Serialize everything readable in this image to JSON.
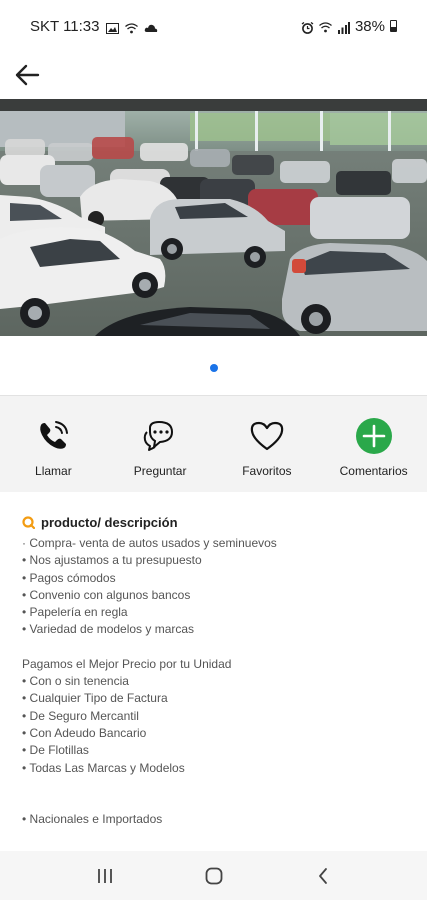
{
  "status_bar": {
    "carrier_time": "SKT 11:33",
    "battery": "38%"
  },
  "colors": {
    "accent_blue": "#1a73e8",
    "comment_green": "#2aa84a",
    "tag_orange": "#f39c12"
  },
  "actions": [
    {
      "label": "Llamar",
      "icon": "phone-icon"
    },
    {
      "label": "Preguntar",
      "icon": "chat-bubbles-icon"
    },
    {
      "label": "Favoritos",
      "icon": "heart-icon"
    },
    {
      "label": "Comentarios",
      "icon": "plus-circle-icon"
    }
  ],
  "description": {
    "title": "producto/ descripción",
    "lines_1": [
      "· Compra- venta de autos usados y seminuevos",
      "• Nos ajustamos a tu presupuesto",
      "• Pagos cómodos",
      "• Convenio con algunos bancos",
      "• Papelería en regla",
      "• Variedad de modelos y marcas"
    ],
    "lines_2": [
      "Pagamos el Mejor Precio por tu Unidad",
      "• Con o sin tenencia",
      "• Cualquier Tipo de Factura",
      "• De Seguro Mercantil",
      "• Con Adeudo Bancario",
      "• De Flotillas",
      "• Todas Las Marcas y Modelos"
    ],
    "lines_3": [
      "• Nacionales e Importados"
    ]
  },
  "image": {
    "subject": "car-dealership-lot-photo"
  }
}
